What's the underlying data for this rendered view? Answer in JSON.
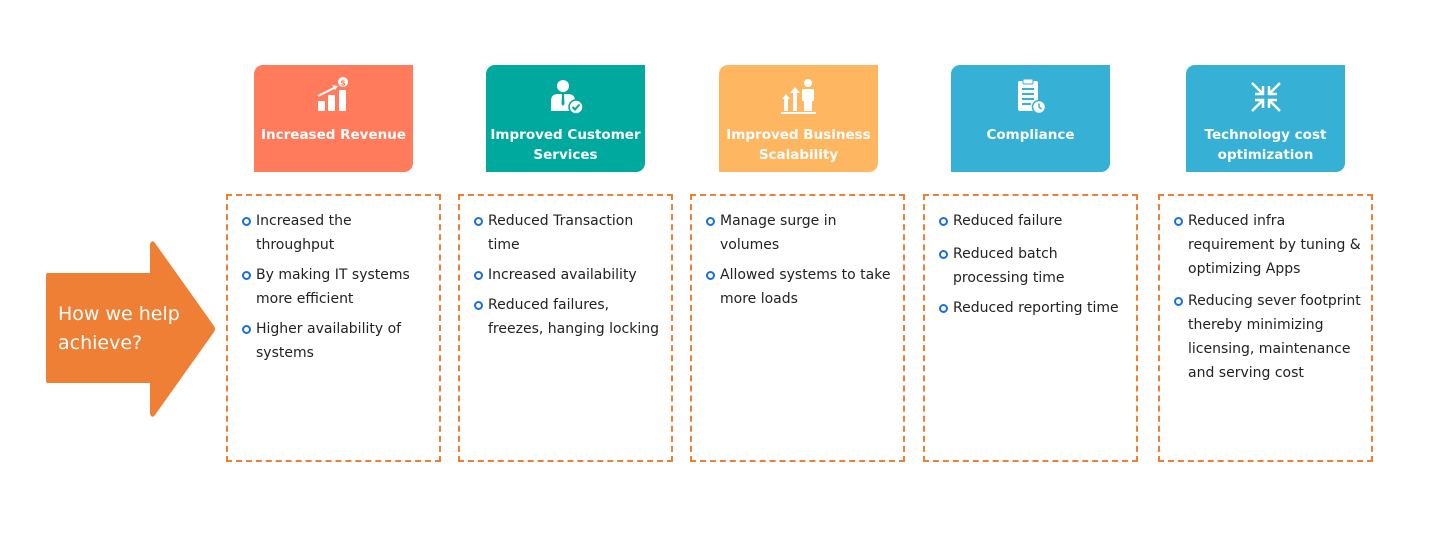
{
  "arrow": {
    "label": "How we help achieve?",
    "color": "#ee7f35"
  },
  "columns": [
    {
      "title": "Increased Revenue",
      "icon": "revenue-growth-icon",
      "color": "#ff7b5c",
      "items": [
        "Increased the throughput",
        "By making IT systems more efficient",
        "Higher availability of systems"
      ]
    },
    {
      "title": "Improved Customer Services",
      "icon": "customer-service-check-icon",
      "color": "#00a99d",
      "items": [
        "Reduced Transaction time",
        "Increased availability",
        "Reduced failures, freezes, hanging locking"
      ]
    },
    {
      "title": "Improved Business Scalability",
      "icon": "scalability-person-arrows-icon",
      "color": "#ffb661",
      "items": [
        "Manage surge in volumes",
        "Allowed systems to take more loads"
      ]
    },
    {
      "title": "Compliance",
      "icon": "clipboard-clock-icon",
      "color": "#36b0d4",
      "items": [
        "Reduced failure",
        "Reduced batch processing time",
        "Reduced reporting time"
      ]
    },
    {
      "title": "Technology cost optimization",
      "icon": "compress-arrows-icon",
      "color": "#36b0d4",
      "items": [
        "Reduced infra requirement by tuning & optimizing  Apps",
        "Reducing sever footprint thereby minimizing licensing, maintenance and serving cost"
      ]
    }
  ],
  "colors": {
    "dashed_border": "#ee7f35",
    "bullet": "#1a6fe0",
    "text": "#222222"
  }
}
